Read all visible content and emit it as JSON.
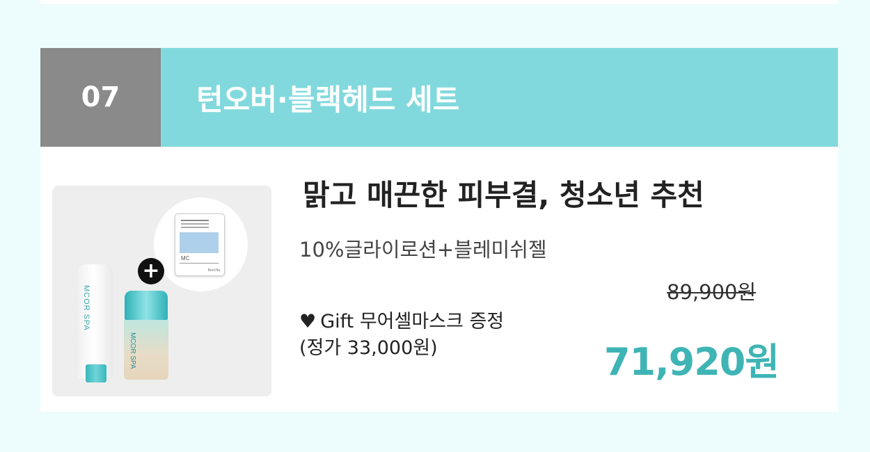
{
  "section": {
    "number": "07",
    "title": "턴오버·블랙헤드 세트"
  },
  "product": {
    "headline": "맑고 매끈한 피부결, 청소년 추천",
    "subtitle": "10%글라이로션+블레미쉬젤",
    "gift_icon": "heart-icon",
    "gift_line1": "Gift 무어셀마스크 증정",
    "gift_line2": "(정가 33,000원)",
    "original_price": "89,900원",
    "sale_price": "71,920원",
    "image": {
      "plus_icon": "plus-icon",
      "mask_label": "MC",
      "mask_brand": "BeeVita",
      "tube_label": "MCOR SPA",
      "jar_label": "MCOR SPA"
    }
  },
  "colors": {
    "page_background": "#edfcfd",
    "number_background": "#8a8a8a",
    "title_background": "#82d9dd",
    "sale_price": "#3fb4b5"
  }
}
